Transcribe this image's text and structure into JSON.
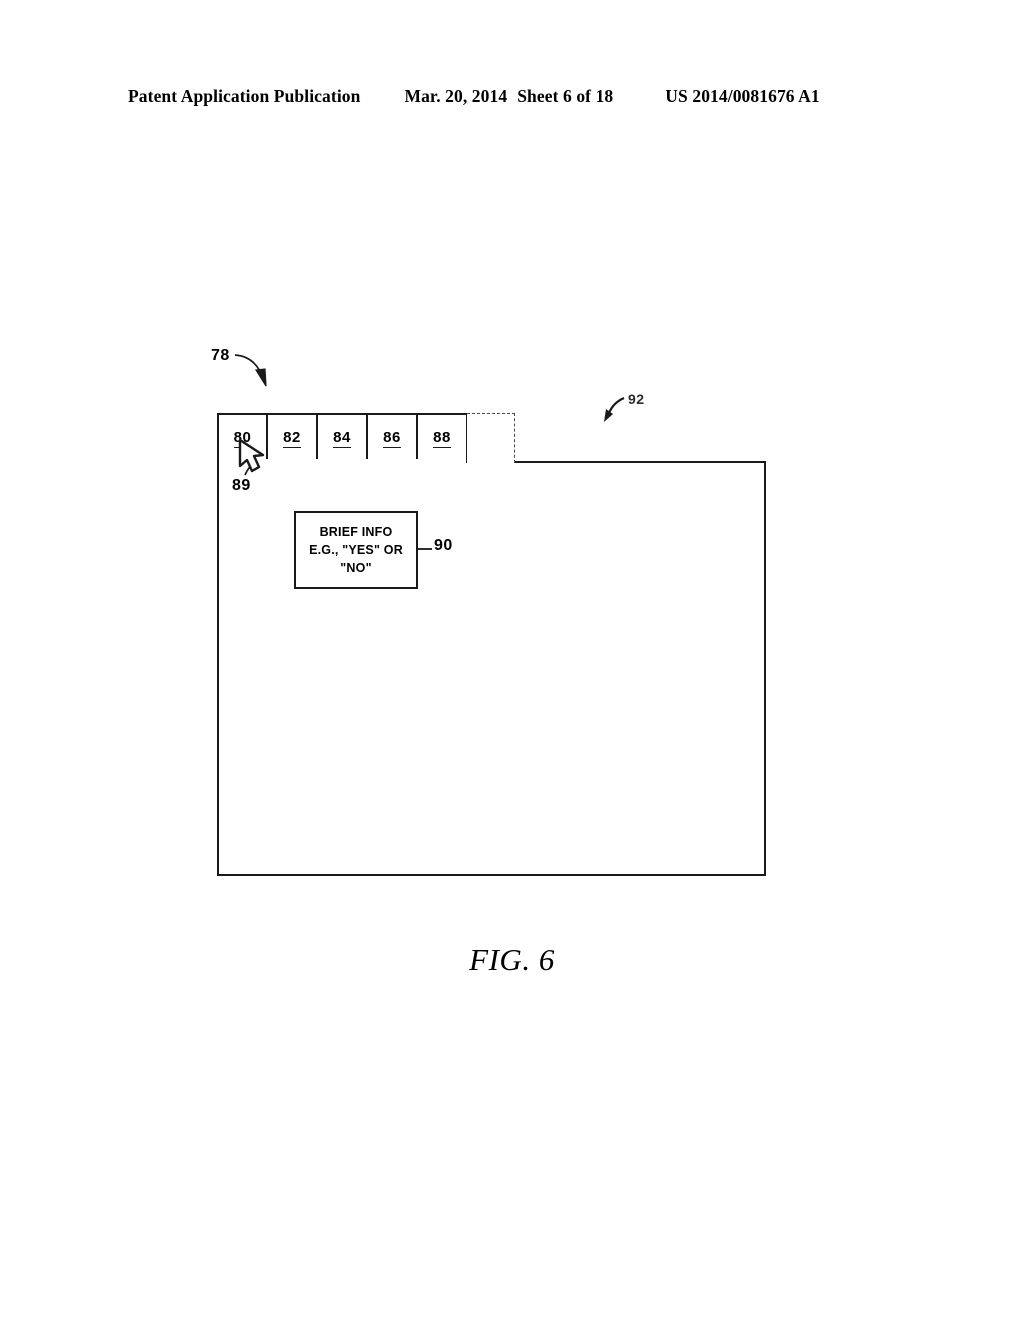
{
  "header": {
    "publication": "Patent Application Publication",
    "date": "Mar. 20, 2014",
    "sheet": "Sheet 6 of 18",
    "patent_number": "US 2014/0081676 A1"
  },
  "figure": {
    "caption": "FIG. 6",
    "reference_numerals": {
      "window": "78",
      "cursor": "89",
      "brief_info": "90",
      "content_area": "92"
    },
    "tabs": [
      {
        "label": "80",
        "active": true,
        "style": "solid"
      },
      {
        "label": "82",
        "active": false,
        "style": "solid"
      },
      {
        "label": "84",
        "active": false,
        "style": "solid"
      },
      {
        "label": "86",
        "active": false,
        "style": "solid"
      },
      {
        "label": "88",
        "active": false,
        "style": "solid"
      }
    ],
    "placeholder_tab": {
      "style": "dashed"
    },
    "brief_info_box": {
      "line1": "BRIEF INFO",
      "line2": "E.G., \"YES\" OR \"NO\""
    }
  },
  "colors": {
    "ink": "#1a1a1a",
    "dashed_ink": "#4a4a4a",
    "paper": "#ffffff"
  }
}
